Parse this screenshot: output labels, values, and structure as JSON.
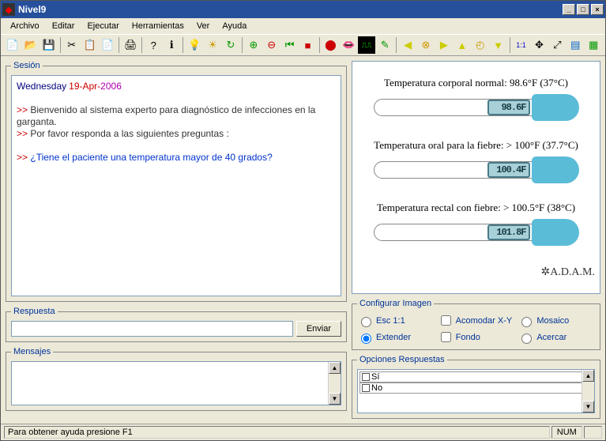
{
  "window": {
    "title": "Nivel9"
  },
  "menu": {
    "items": [
      "Archivo",
      "Editar",
      "Ejecutar",
      "Herramientas",
      "Ver",
      "Ayuda"
    ]
  },
  "session": {
    "legend": "Sesión",
    "day": "Wednesday",
    "date_day": "19-Apr-",
    "date_year": "2006",
    "welcome1": "Bienvenido al sistema experto para diagnóstico de infecciones en la garganta.",
    "welcome2": "Por favor responda a las siguientes preguntas :",
    "question": "¿Tiene el paciente una temperatura mayor de 40 grados?"
  },
  "respuesta": {
    "legend": "Respuesta",
    "value": "",
    "send": "Enviar"
  },
  "mensajes": {
    "legend": "Mensajes"
  },
  "thermos": [
    {
      "label": "Temperatura corporal normal: 98.6°F (37°C)",
      "display": "98.6F"
    },
    {
      "label": "Temperatura oral para la fiebre: > 100°F (37.7°C)",
      "display": "100.4F"
    },
    {
      "label": "Temperatura rectal con fiebre: > 100.5°F (38°C)",
      "display": "101.8F"
    }
  ],
  "adam": "✲A.D.A.M.",
  "config": {
    "legend": "Configurar Imagen",
    "esc": "Esc 1:1",
    "extender": "Extender",
    "acomodar": "Acomodar X-Y",
    "fondo": "Fondo",
    "mosaico": "Mosaico",
    "acercar": "Acercar",
    "selected": "extender"
  },
  "opciones": {
    "legend": "Opciones Respuestas",
    "items": [
      "Sí",
      "No"
    ]
  },
  "status": {
    "help": "Para obtener ayuda presione F1",
    "num": "NUM"
  }
}
